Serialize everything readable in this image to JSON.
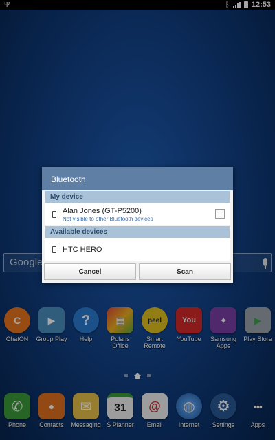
{
  "status_bar": {
    "time": "12:53"
  },
  "search": {
    "logo_text": "Google"
  },
  "apps": [
    {
      "label": "ChatON",
      "icon": "chaton-icon",
      "color": "#e8761e",
      "glyph": "C"
    },
    {
      "label": "Group Play",
      "icon": "group-play-icon",
      "color": "#4b8fbf",
      "glyph": "▶"
    },
    {
      "label": "Help",
      "icon": "help-icon",
      "color": "#2c7bd1",
      "glyph": "?"
    },
    {
      "label": "Polaris Office",
      "icon": "polaris-office-icon",
      "color": "#5aa43c",
      "glyph": "▤"
    },
    {
      "label": "Smart Remote",
      "icon": "smart-remote-icon",
      "color": "#e0c21f",
      "glyph": "peel"
    },
    {
      "label": "YouTube",
      "icon": "youtube-icon",
      "color": "#d62a2a",
      "glyph": "You"
    },
    {
      "label": "Samsung Apps",
      "icon": "samsung-apps-icon",
      "color": "#7b3fa6",
      "glyph": "✦"
    },
    {
      "label": "Play Store",
      "icon": "play-store-icon",
      "color": "#9aa3ab",
      "glyph": "▶"
    }
  ],
  "dock": [
    {
      "label": "Phone",
      "icon": "phone-icon",
      "color": "#3c9b3c",
      "glyph": "✆"
    },
    {
      "label": "Contacts",
      "icon": "contacts-icon",
      "color": "#e07020",
      "glyph": "👤"
    },
    {
      "label": "Messaging",
      "icon": "messaging-icon",
      "color": "#e8c04a",
      "glyph": "✉"
    },
    {
      "label": "S Planner",
      "icon": "s-planner-icon",
      "color": "#f2f2f2",
      "glyph": "31"
    },
    {
      "label": "Email",
      "icon": "email-icon",
      "color": "#f2f2f2",
      "glyph": "@"
    },
    {
      "label": "Internet",
      "icon": "internet-icon",
      "color": "#2b6cb5",
      "glyph": "◍"
    },
    {
      "label": "Settings",
      "icon": "settings-icon",
      "color": "#2a5a95",
      "glyph": "⚙"
    },
    {
      "label": "Apps",
      "icon": "apps-grid-icon",
      "color": "#3f4a5a",
      "glyph": "⋮⋮⋮"
    }
  ],
  "dialog": {
    "title": "Bluetooth",
    "my_device_header": "My device",
    "my_device": {
      "name": "Alan Jones (GT-P5200)",
      "status": "Not visible to other Bluetooth devices"
    },
    "available_header": "Available devices",
    "available_devices": [
      {
        "name": "HTC HERO"
      }
    ],
    "cancel_label": "Cancel",
    "scan_label": "Scan"
  }
}
